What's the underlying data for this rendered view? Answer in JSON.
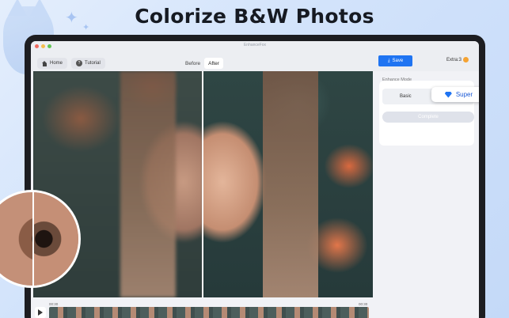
{
  "headline": "Colorize B&W Photos",
  "window": {
    "title": "EnhanceFox"
  },
  "toolbar": {
    "home_label": "Home",
    "tutorial_label": "Tutorial",
    "before_label": "Before",
    "after_label": "After",
    "save_label": "Save",
    "extra_label": "Extra:3"
  },
  "player": {
    "time_start": "00:30",
    "time_end": "00:30"
  },
  "panel": {
    "title": "Enhance Mode",
    "basic_label": "Basic",
    "super_label": "Super",
    "complete_label": "Complete"
  },
  "colors": {
    "accent": "#1f74f2",
    "coin": "#f5a332"
  },
  "icons": [
    "home-icon",
    "question-icon",
    "save-icon",
    "coin-icon",
    "play-icon",
    "gem-icon"
  ]
}
